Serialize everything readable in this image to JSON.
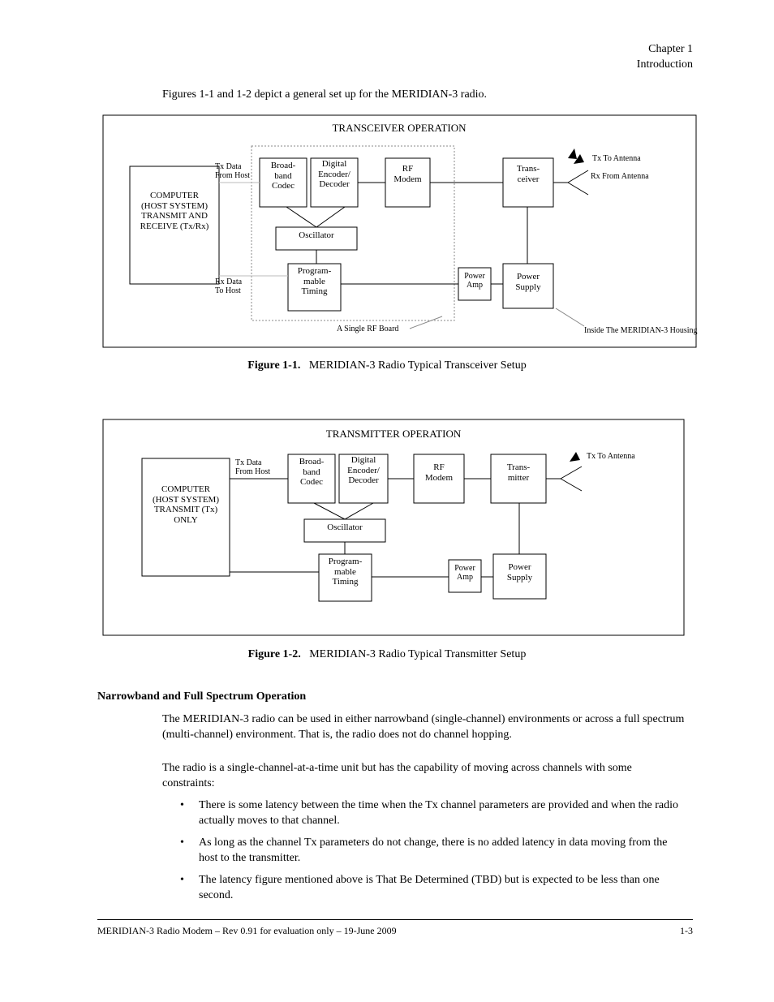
{
  "header": {
    "runhead": "Chapter 1",
    "title": "Introduction"
  },
  "intro_text": "Figures 1-1 and 1-2 depict a general set up for the MERIDIAN-3 radio.",
  "fig5": {
    "caption_lead": "Figure 1-1.",
    "caption_text": "MERIDIAN-3 Radio Typical Transceiver Setup",
    "outer_title": "TRANSCEIVER OPERATION",
    "box_tx": "COMPUTER\n(HOST SYSTEM)\nTRANSMIT AND\nRECEIVE (Tx/Rx)",
    "box_bbc": "Broad-\nband\nCodec",
    "box_enc": "Digital\nEncoder/\nDecoder",
    "box_rf": "RF\nModem",
    "box_trx": "Trans-\nceiver",
    "box_osc": "Oscillator",
    "box_prog": "Program-\nmable\nTiming",
    "box_amp": "Power\nAmp",
    "box_ps": "Power\nSupply",
    "label_txdata": "Tx Data\nFrom Host",
    "label_rxdata": "Rx Data\nTo Host",
    "label_tx_ant": "Tx To Antenna",
    "label_rx_ant": "Rx From Antenna",
    "label_in_housing": "Inside The MERIDIAN-3 Housing",
    "label_single_rf": "A Single RF Board"
  },
  "fig6": {
    "caption_lead": "Figure 1-2.",
    "caption_text": "MERIDIAN-3 Radio Typical Transmitter Setup",
    "outer_title": "TRANSMITTER OPERATION",
    "box_tx": "COMPUTER\n(HOST SYSTEM)\nTRANSMIT (Tx)\nONLY",
    "box_bbc": "Broad-\nband\nCodec",
    "box_enc": "Digital\nEncoder/\nDecoder",
    "box_rf": "RF\nModem",
    "box_trx": "Trans-\nmitter",
    "box_osc": "Oscillator",
    "box_prog": "Program-\nmable\nTiming",
    "box_amp": "Power\nAmp",
    "box_ps": "Power\nSupply",
    "label_txdata": "Tx Data\nFrom Host",
    "label_tx_ant": "Tx To Antenna"
  },
  "afterword": {
    "narrow_heading": "Narrowband and Full Spectrum Operation",
    "p1": "The MERIDIAN-3 radio can be used in either narrowband (single-channel) environments or across a full spectrum (multi-channel) environment. That is, the radio does not do channel hopping.",
    "p2": "The radio is a single-channel-at-a-time unit but has the capability of moving across channels with some constraints:",
    "bullet1": "There is some latency between the time when the Tx channel parameters are provided and when the radio actually moves to that channel.",
    "bullet2": "As long as the channel Tx parameters do not change, there is no added latency in data moving from the host to the transmitter.",
    "bullet3": "The latency figure mentioned above is That Be Determined (TBD) but is expected to be less than one second."
  },
  "footer": {
    "left": "MERIDIAN-3 Radio Modem – Rev 0.91 for evaluation only – 19-June 2009",
    "right": "1-3"
  }
}
